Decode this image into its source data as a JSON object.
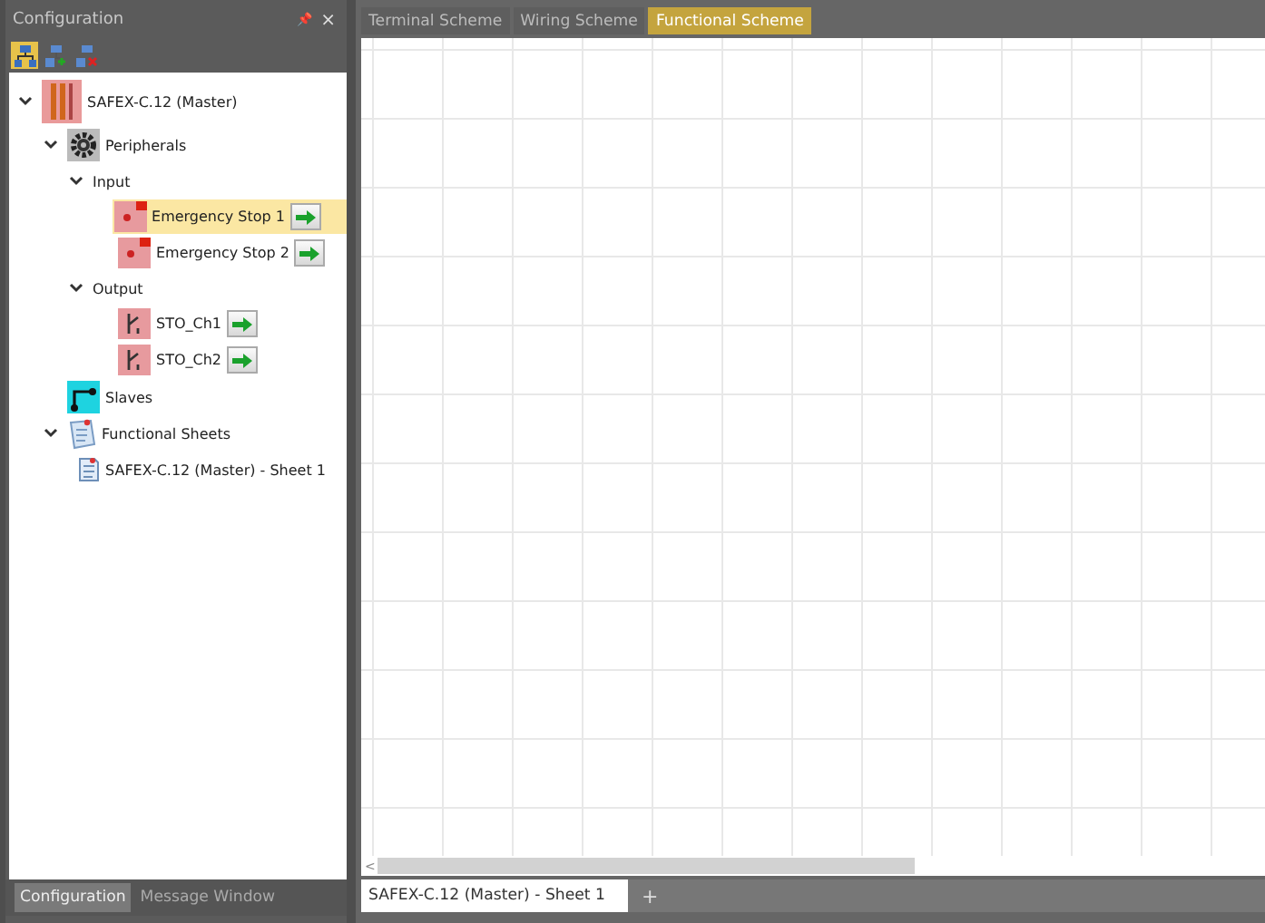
{
  "panel": {
    "title": "Configuration",
    "pin": "📌",
    "close": "×",
    "toolbar": [
      {
        "kind": "tree",
        "selected": true
      },
      {
        "kind": "add",
        "selected": false
      },
      {
        "kind": "remove",
        "selected": false
      }
    ],
    "tree": [
      {
        "label": "SAFEX-C.12 (Master)",
        "kind": "controller",
        "expanded": true,
        "selected": false,
        "children": [
          {
            "label": "Peripherals",
            "kind": "gear",
            "expanded": true,
            "selected": false,
            "children": [
              {
                "label": "Input",
                "kind": "group",
                "expanded": true,
                "selected": false,
                "children": [
                  {
                    "label": "Emergency Stop 1",
                    "kind": "sensor",
                    "selected": true,
                    "go": true
                  },
                  {
                    "label": "Emergency Stop 2",
                    "kind": "sensor",
                    "selected": false,
                    "go": true
                  }
                ]
              },
              {
                "label": "Output",
                "kind": "group",
                "expanded": true,
                "selected": false,
                "children": [
                  {
                    "label": "STO_Ch1",
                    "kind": "output",
                    "selected": false,
                    "go": true
                  },
                  {
                    "label": "STO_Ch2",
                    "kind": "output",
                    "selected": false,
                    "go": true
                  }
                ]
              }
            ]
          },
          {
            "label": "Slaves",
            "kind": "slaves",
            "selected": false
          },
          {
            "label": "Functional Sheets",
            "kind": "sheets",
            "expanded": true,
            "selected": false,
            "children": [
              {
                "label": "SAFEX-C.12 (Master) - Sheet 1",
                "kind": "sheet",
                "selected": false
              }
            ]
          }
        ]
      }
    ],
    "bottom_tabs": [
      {
        "label": "Configuration",
        "selected": true
      },
      {
        "label": "Message Window",
        "selected": false
      }
    ]
  },
  "document": {
    "tabs": [
      {
        "label": "Terminal Scheme",
        "selected": false
      },
      {
        "label": "Wiring Scheme",
        "selected": false
      },
      {
        "label": "Functional Scheme",
        "selected": true
      }
    ],
    "sheet_tabs": [
      {
        "label": "SAFEX-C.12 (Master) - Sheet 1",
        "selected": true
      }
    ],
    "add_tab": "+",
    "scroll_left": "<"
  }
}
